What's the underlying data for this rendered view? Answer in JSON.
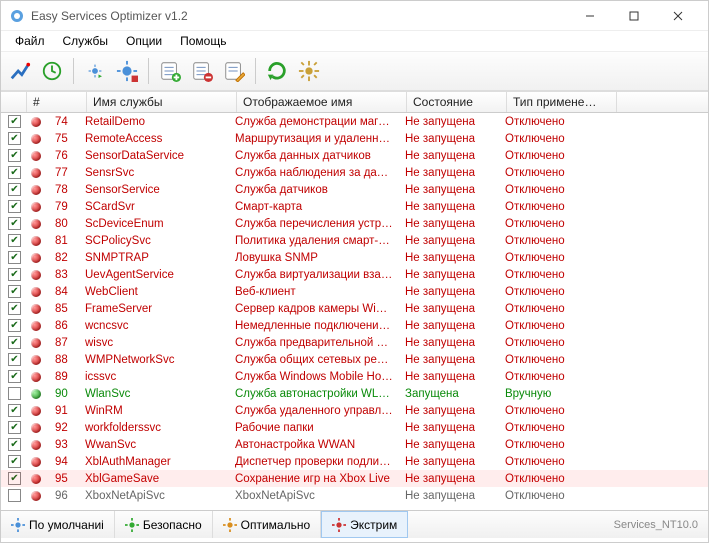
{
  "title": "Easy Services Optimizer v1.2",
  "menu": [
    "Файл",
    "Службы",
    "Опции",
    "Помощь"
  ],
  "columns": {
    "num": "#",
    "name": "Имя службы",
    "disp": "Отображаемое имя",
    "stat": "Состояние",
    "type": "Тип примене…"
  },
  "status_buttons": [
    "По умолчаниі",
    "Безопасно",
    "Оптимально",
    "Экстрим"
  ],
  "status_active_index": 3,
  "status_right": "Services_NT10.0",
  "rows": [
    {
      "checked": true,
      "bullet": "red",
      "num": 74,
      "name": "RetailDemo",
      "disp": "Служба демонстрации магазина",
      "stat": "Не запущена",
      "type": "Отключено",
      "color": "red"
    },
    {
      "checked": true,
      "bullet": "red",
      "num": 75,
      "name": "RemoteAccess",
      "disp": "Маршрутизация и удаленный…",
      "stat": "Не запущена",
      "type": "Отключено",
      "color": "red"
    },
    {
      "checked": true,
      "bullet": "red",
      "num": 76,
      "name": "SensorDataService",
      "disp": "Служба данных датчиков",
      "stat": "Не запущена",
      "type": "Отключено",
      "color": "red"
    },
    {
      "checked": true,
      "bullet": "red",
      "num": 77,
      "name": "SensrSvc",
      "disp": "Служба наблюдения за датч…",
      "stat": "Не запущена",
      "type": "Отключено",
      "color": "red"
    },
    {
      "checked": true,
      "bullet": "red",
      "num": 78,
      "name": "SensorService",
      "disp": "Служба датчиков",
      "stat": "Не запущена",
      "type": "Отключено",
      "color": "red"
    },
    {
      "checked": true,
      "bullet": "red",
      "num": 79,
      "name": "SCardSvr",
      "disp": "Смарт-карта",
      "stat": "Не запущена",
      "type": "Отключено",
      "color": "red"
    },
    {
      "checked": true,
      "bullet": "red",
      "num": 80,
      "name": "ScDeviceEnum",
      "disp": "Служба перечисления устрой…",
      "stat": "Не запущена",
      "type": "Отключено",
      "color": "red"
    },
    {
      "checked": true,
      "bullet": "red",
      "num": 81,
      "name": "SCPolicySvc",
      "disp": "Политика удаления смарт-карт",
      "stat": "Не запущена",
      "type": "Отключено",
      "color": "red"
    },
    {
      "checked": true,
      "bullet": "red",
      "num": 82,
      "name": "SNMPTRAP",
      "disp": "Ловушка SNMP",
      "stat": "Не запущена",
      "type": "Отключено",
      "color": "red"
    },
    {
      "checked": true,
      "bullet": "red",
      "num": 83,
      "name": "UevAgentService",
      "disp": "Служба виртуализации взаим…",
      "stat": "Не запущена",
      "type": "Отключено",
      "color": "red"
    },
    {
      "checked": true,
      "bullet": "red",
      "num": 84,
      "name": "WebClient",
      "disp": "Веб-клиент",
      "stat": "Не запущена",
      "type": "Отключено",
      "color": "red"
    },
    {
      "checked": true,
      "bullet": "red",
      "num": 85,
      "name": "FrameServer",
      "disp": "Сервер кадров камеры Windo…",
      "stat": "Не запущена",
      "type": "Отключено",
      "color": "red"
    },
    {
      "checked": true,
      "bullet": "red",
      "num": 86,
      "name": "wcncsvc",
      "disp": "Немедленные подключения …",
      "stat": "Не запущена",
      "type": "Отключено",
      "color": "red"
    },
    {
      "checked": true,
      "bullet": "red",
      "num": 87,
      "name": "wisvc",
      "disp": "Служба предварительной оц…",
      "stat": "Не запущена",
      "type": "Отключено",
      "color": "red"
    },
    {
      "checked": true,
      "bullet": "red",
      "num": 88,
      "name": "WMPNetworkSvc",
      "disp": "Служба общих сетевых ресу…",
      "stat": "Не запущена",
      "type": "Отключено",
      "color": "red"
    },
    {
      "checked": true,
      "bullet": "red",
      "num": 89,
      "name": "icssvc",
      "disp": "Служба Windows Mobile Hotspot",
      "stat": "Не запущена",
      "type": "Отключено",
      "color": "red"
    },
    {
      "checked": false,
      "bullet": "green",
      "num": 90,
      "name": "WlanSvc",
      "disp": "Служба автонастройки WLAN",
      "stat": "Запущена",
      "type": "Вручную",
      "color": "green"
    },
    {
      "checked": true,
      "bullet": "red",
      "num": 91,
      "name": "WinRM",
      "disp": "Служба удаленного управле…",
      "stat": "Не запущена",
      "type": "Отключено",
      "color": "red"
    },
    {
      "checked": true,
      "bullet": "red",
      "num": 92,
      "name": "workfolderssvc",
      "disp": "Рабочие папки",
      "stat": "Не запущена",
      "type": "Отключено",
      "color": "red"
    },
    {
      "checked": true,
      "bullet": "red",
      "num": 93,
      "name": "WwanSvc",
      "disp": "Автонастройка WWAN",
      "stat": "Не запущена",
      "type": "Отключено",
      "color": "red"
    },
    {
      "checked": true,
      "bullet": "red",
      "num": 94,
      "name": "XblAuthManager",
      "disp": "Диспетчер проверки подлин…",
      "stat": "Не запущена",
      "type": "Отключено",
      "color": "red"
    },
    {
      "checked": true,
      "bullet": "red",
      "num": 95,
      "name": "XblGameSave",
      "disp": "Сохранение игр на Xbox Live",
      "stat": "Не запущена",
      "type": "Отключено",
      "color": "red",
      "highlight": true
    },
    {
      "checked": false,
      "bullet": "red",
      "num": 96,
      "name": "XboxNetApiSvc",
      "disp": "XboxNetApiSvc",
      "stat": "Не запущена",
      "type": "Отключено",
      "color": "gray"
    }
  ]
}
